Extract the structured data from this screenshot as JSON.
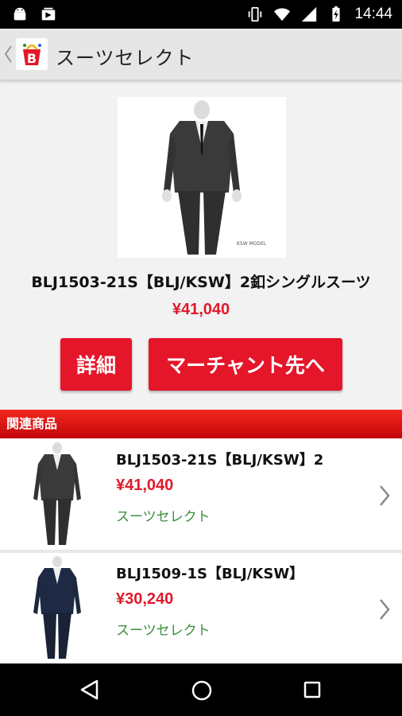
{
  "status_bar": {
    "time": "14:44",
    "left_icons": [
      "android-icon",
      "photo-icon"
    ],
    "right_icons": [
      "vibrate-icon",
      "wifi-icon",
      "signal-icon",
      "battery-charging-icon"
    ]
  },
  "action_bar": {
    "title": "スーツセレクト",
    "logo_letter": "B"
  },
  "product": {
    "title": "BLJ1503-21S【BLJ/KSW】2釦シングルスーツ",
    "price": "¥41,040",
    "detail_button": "詳細",
    "merchant_button": "マーチャント先へ",
    "image_caption": "KSW MODEL"
  },
  "related": {
    "header": "関連商品",
    "items": [
      {
        "title": "BLJ1503-21S【BLJ/KSW】2",
        "price": "¥41,040",
        "shop": "スーツセレクト",
        "suit_color": "#3a3a3a"
      },
      {
        "title": "BLJ1509-1S【BLJ/KSW】",
        "price": "¥30,240",
        "shop": "スーツセレクト",
        "suit_color": "#1e2a44"
      }
    ]
  },
  "colors": {
    "accent": "#e5162a",
    "price": "#e0192b",
    "shop": "#3e8e3e"
  }
}
